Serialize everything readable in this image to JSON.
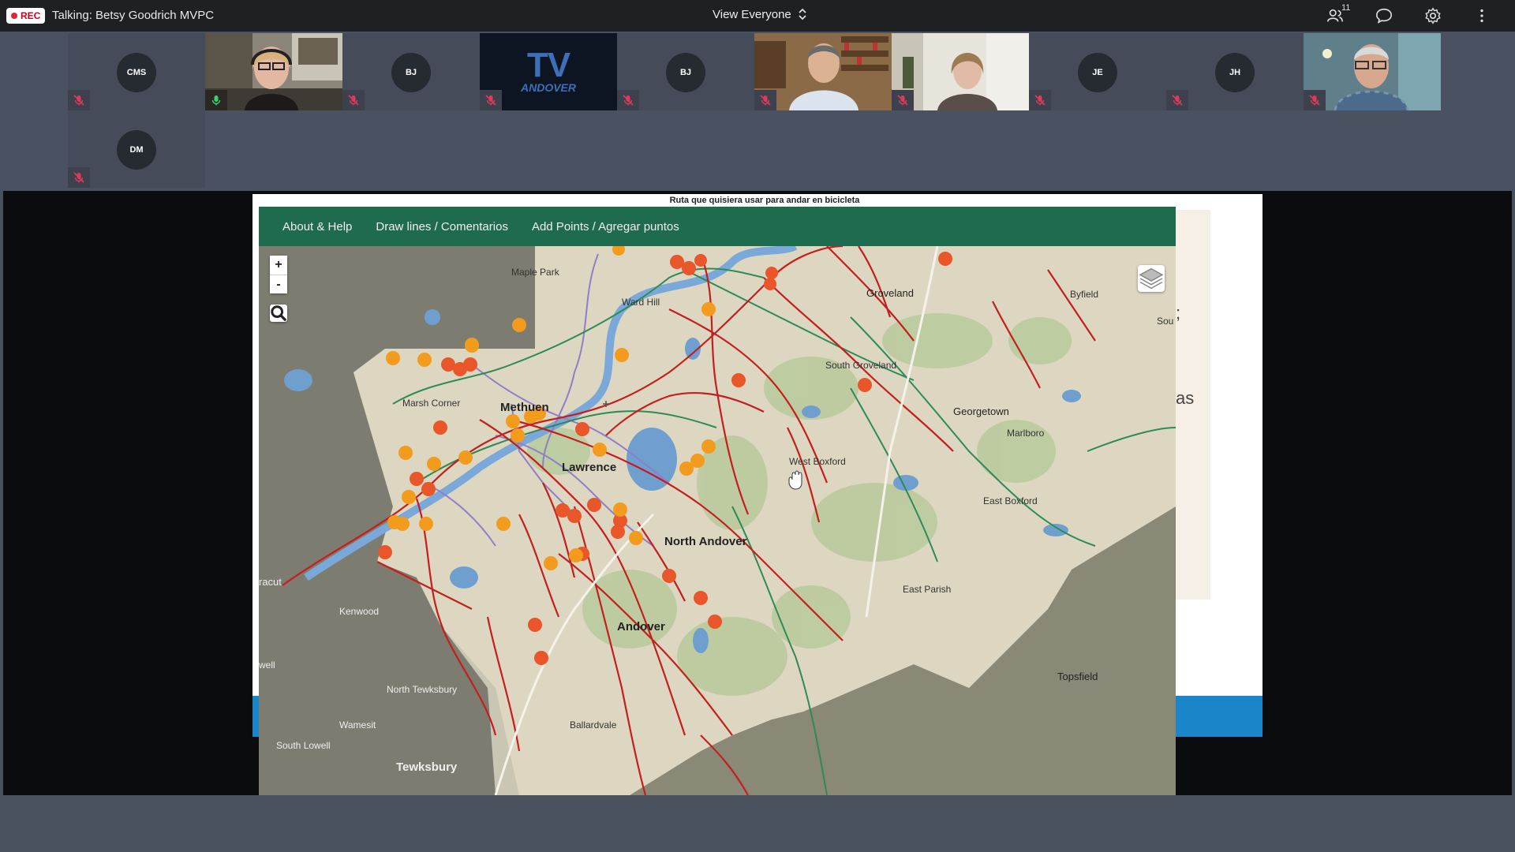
{
  "topbar": {
    "rec_label": "REC",
    "talking": "Talking: Betsy Goodrich MVPC",
    "view_mode": "View Everyone",
    "participant_count": "11"
  },
  "participants": [
    {
      "initials": "CMS",
      "type": "avatar",
      "muted": true
    },
    {
      "initials": "",
      "type": "video",
      "muted": false,
      "speaking": true
    },
    {
      "initials": "BJ",
      "type": "avatar",
      "muted": true
    },
    {
      "initials": "",
      "type": "logo",
      "logo_text": "TV",
      "logo_sub": "ANDOVER",
      "muted": true
    },
    {
      "initials": "BJ",
      "type": "avatar",
      "muted": true
    },
    {
      "initials": "",
      "type": "video",
      "muted": true
    },
    {
      "initials": "",
      "type": "video",
      "muted": true
    },
    {
      "initials": "JE",
      "type": "avatar",
      "muted": true
    },
    {
      "initials": "JH",
      "type": "avatar",
      "muted": true
    },
    {
      "initials": "",
      "type": "video",
      "muted": true
    },
    {
      "initials": "DM",
      "type": "avatar",
      "muted": true
    }
  ],
  "shared_screen": {
    "caption": "Ruta que quisiera usar para andar en bicicleta",
    "right_text": [
      ";",
      "as"
    ],
    "nav": {
      "about": "About & Help",
      "draw": "Draw lines / Comentarios",
      "add": "Add Points / Agregar puntos"
    },
    "zoom_in": "+",
    "zoom_out": "-",
    "places": {
      "maple_park": "Maple Park",
      "ward_hill": "Ward Hill",
      "groveland": "Groveland",
      "byfield": "Byfield",
      "south_groveland": "South Groveland",
      "methuen": "Methuen",
      "marsh_corner": "Marsh Corner",
      "georgetown": "Georgetown",
      "marlboro": "Marlboro",
      "west_boxford": "West Boxford",
      "lawrence": "Lawrence",
      "east_boxford": "East Boxford",
      "north_andover": "North Andover",
      "racut": "racut",
      "kenwood": "Kenwood",
      "east_parish": "East Parish",
      "andover": "Andover",
      "topsfield": "Topsfield",
      "north_tewksbury": "North Tewksbury",
      "wamesit": "Wamesit",
      "south_lowell": "South Lowell",
      "ballardvale": "Ballardvale",
      "tewksbury": "Tewksbury",
      "well": "well",
      "sou": "Sou"
    }
  },
  "colors": {
    "nav_green": "#1f6b4e",
    "bike_marker": "#e8562a",
    "walk_marker": "#f29b1c",
    "route_red": "#c41e1e",
    "route_green": "#2e8b57",
    "route_purple": "#8f7fc8",
    "accent_blue": "#1a86c9"
  }
}
